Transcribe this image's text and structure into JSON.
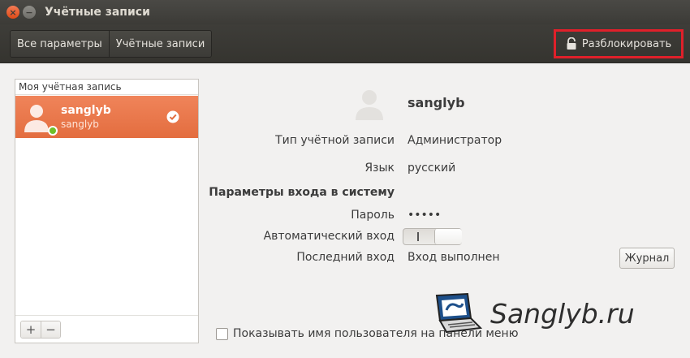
{
  "window": {
    "title": "Учётные записи",
    "close_glyph": "×",
    "minimize_glyph": "−"
  },
  "toolbar": {
    "breadcrumbs": [
      "Все параметры",
      "Учётные записи"
    ],
    "unlock_label": "Разблокировать",
    "highlight_color": "#e0202a"
  },
  "sidebar": {
    "header": "Моя учётная запись",
    "selected_user": {
      "name": "sanglyb",
      "login": "sanglyb"
    },
    "add_label": "+",
    "remove_label": "−",
    "selection_color": "#e8723f"
  },
  "details": {
    "user_name": "sanglyb",
    "account_type_label": "Тип учётной записи",
    "account_type_value": "Администратор",
    "language_label": "Язык",
    "language_value": "русский",
    "login_section_title": "Параметры входа в систему",
    "password_label": "Пароль",
    "password_value": "•••••",
    "autologin_label": "Автоматический вход",
    "autologin_enabled": false,
    "last_login_label": "Последний вход",
    "last_login_value": "Вход выполнен",
    "history_button": "Журнал"
  },
  "footer": {
    "show_username_label": "Показывать имя пользователя на панели меню",
    "show_username_checked": false
  },
  "watermark": {
    "text": "Sanglyb.ru"
  }
}
